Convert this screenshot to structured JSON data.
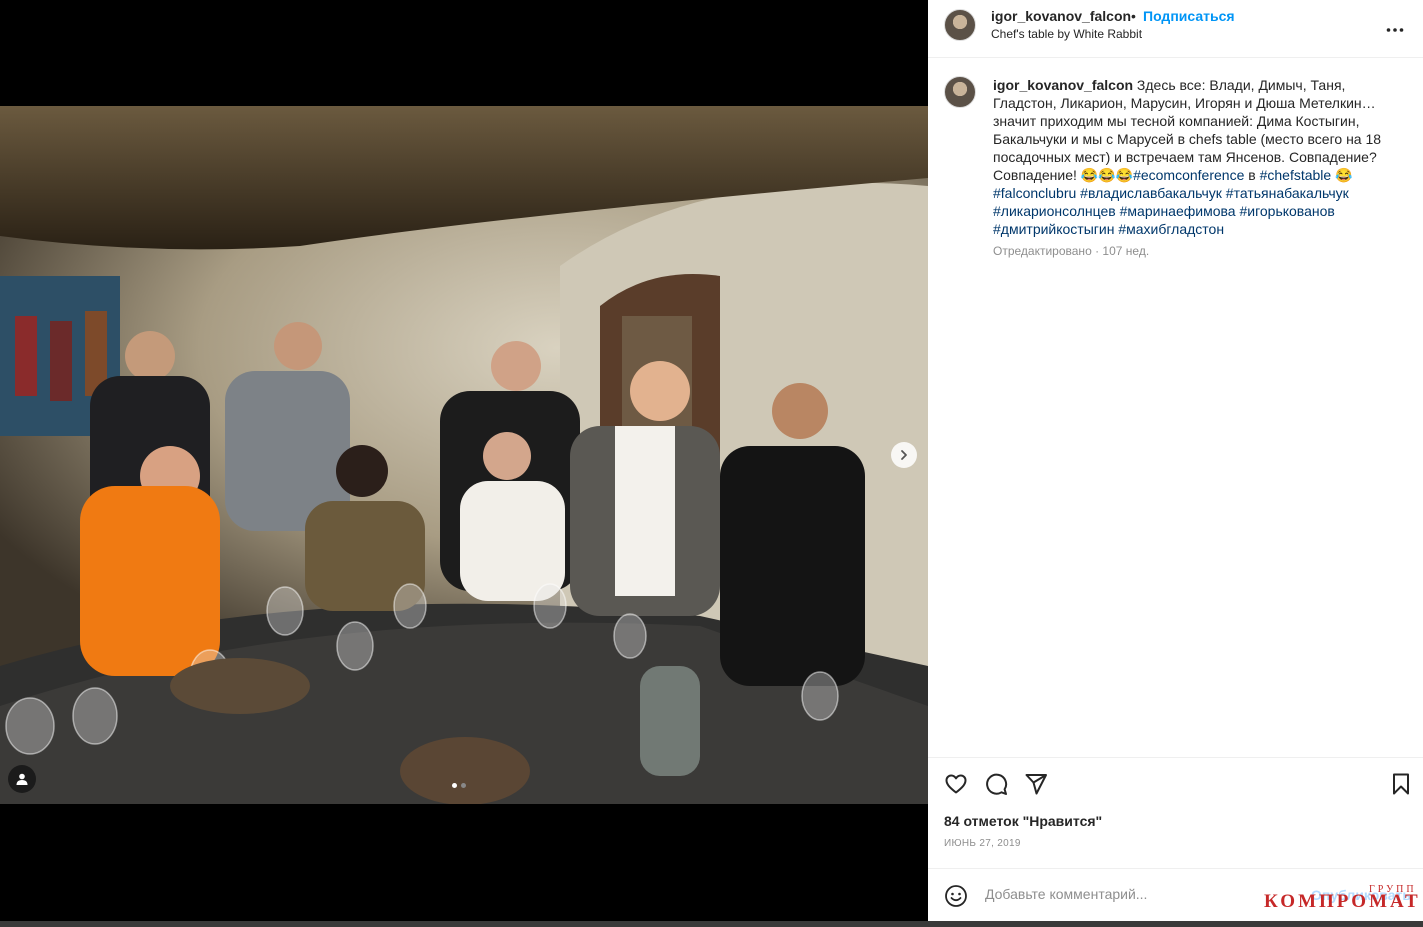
{
  "header": {
    "username": "igor_kovanov_falcon",
    "separator": "•",
    "follow_label": "Подписаться",
    "location": "Chef's table by White Rabbit",
    "more_icon": "more-horizontal-icon"
  },
  "caption": {
    "username": "igor_kovanov_falcon",
    "text_1": " Здесь все: Влади, Димыч, Таня, Гладстон, Ликарион, Марусин, Игорян и Дюша Метелкин… значит приходим мы тесной компанией: Дима Костыгин, Бакальчуки и мы с Марусей в chefs table (место всего на 18 посадочных мест) и встречаем там Янсенов. Совпадение? Совпадение! 😂😂😂",
    "tag_ecomconference": "#ecomconference",
    "text_2": " в ",
    "tag_chefstable": "#chefstable",
    "text_3": " 😂",
    "tag_falconclubru": "#falconclubru",
    "tag_vladislav": "#владиславбакальчук",
    "tag_tatyana": "#татьянабакальчук",
    "tag_likarion": "#ликарионсолнцев",
    "tag_marina": "#маринаефимова",
    "tag_igor": "#игорькованов",
    "tag_dmitriy": "#дмитрийкостыгин",
    "tag_mahib": "#махибгладстон",
    "edited": "Отредактировано",
    "dot": " · ",
    "age": "107 нед."
  },
  "media": {
    "carousel_count": 2,
    "active_index": 0,
    "next_icon": "chevron-right-icon",
    "tag_icon": "user-tag-icon"
  },
  "actions": {
    "like_icon": "heart-icon",
    "comment_icon": "comment-icon",
    "share_icon": "send-icon",
    "save_icon": "bookmark-icon"
  },
  "likes_text": "84 отметок \"Нравится\"",
  "date_text": "ИЮНЬ 27, 2019",
  "comment": {
    "placeholder": "Добавьте комментарий...",
    "publish_label": "Опубликовать",
    "emoji_icon": "smile-icon"
  },
  "watermark": {
    "top": "ГРУПП",
    "main": "КОМПРОМАТ"
  },
  "colors": {
    "accent": "#0095f6",
    "hashtag": "#00376b",
    "muted": "#8e8e8e",
    "watermark": "#c62828"
  }
}
